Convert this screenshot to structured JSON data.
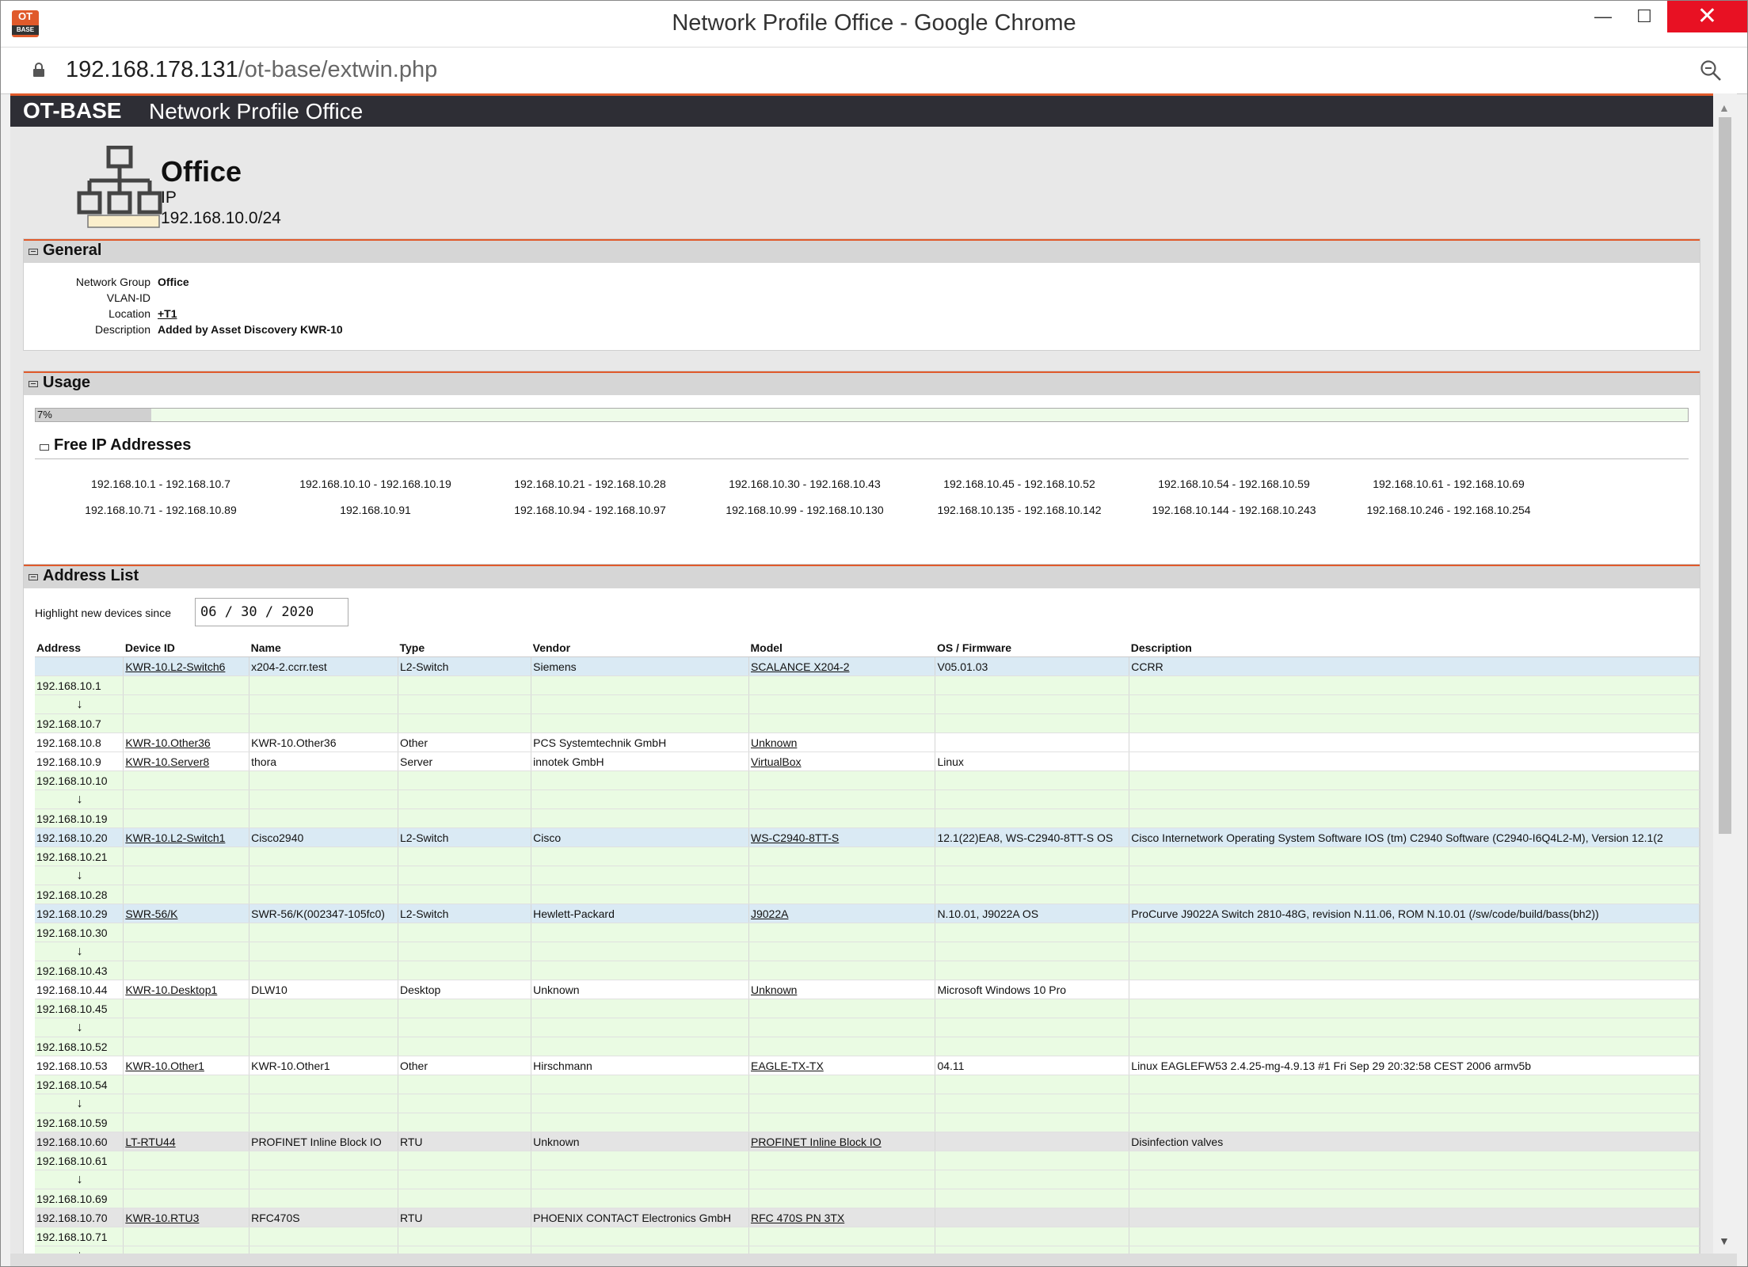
{
  "window": {
    "logo_top": "OT",
    "logo_bottom": "BASE",
    "title": "Network Profile Office - Google Chrome",
    "minimize": "—",
    "maximize": "☐",
    "close": "✕"
  },
  "addressbar": {
    "url_host": "192.168.178.131",
    "url_path": "/ot-base/extwin.php"
  },
  "header": {
    "brand": "OT-BASE",
    "title": "Network Profile  Office"
  },
  "profile": {
    "name": "Office",
    "type": "IP",
    "subnet": "192.168.10.0/24"
  },
  "general": {
    "title": "General",
    "fields": [
      {
        "key": "Network Group",
        "value": "Office",
        "link": false
      },
      {
        "key": "VLAN-ID",
        "value": "",
        "link": false
      },
      {
        "key": "Location",
        "value": "+T1",
        "link": true
      },
      {
        "key": "Description",
        "value": "Added by Asset Discovery KWR-10",
        "link": false
      }
    ]
  },
  "usage": {
    "title": "Usage",
    "percent": 7,
    "label": "7%",
    "free_title": "Free IP Addresses",
    "free": [
      "192.168.10.1 - 192.168.10.7",
      "192.168.10.10 - 192.168.10.19",
      "192.168.10.21 - 192.168.10.28",
      "192.168.10.30 - 192.168.10.43",
      "192.168.10.45 - 192.168.10.52",
      "192.168.10.54 - 192.168.10.59",
      "192.168.10.61 - 192.168.10.69",
      "192.168.10.71 - 192.168.10.89",
      "192.168.10.91",
      "192.168.10.94 - 192.168.10.97",
      "192.168.10.99 - 192.168.10.130",
      "192.168.10.135 - 192.168.10.142",
      "192.168.10.144 - 192.168.10.243",
      "192.168.10.246 - 192.168.10.254"
    ]
  },
  "address_list": {
    "title": "Address List",
    "highlight_label": "Highlight new devices since",
    "highlight_value": "06 / 30 / 2020",
    "columns": [
      "Address",
      "Device ID",
      "Name",
      "Type",
      "Vendor",
      "Model",
      "OS / Firmware",
      "Description"
    ],
    "rows": [
      {
        "kind": "hl",
        "cells": [
          "",
          "KWR-10.L2-Switch6",
          "x204-2.ccrr.test",
          "L2-Switch",
          "Siemens",
          "SCALANCE X204-2",
          "V05.01.03",
          "CCRR"
        ]
      },
      {
        "kind": "free",
        "cells": [
          "192.168.10.1"
        ]
      },
      {
        "kind": "arrow",
        "cells": [
          "↓"
        ]
      },
      {
        "kind": "free",
        "cells": [
          "192.168.10.7"
        ]
      },
      {
        "kind": "dev",
        "cells": [
          "192.168.10.8",
          "KWR-10.Other36",
          "KWR-10.Other36",
          "Other",
          "PCS Systemtechnik GmbH",
          "Unknown",
          "",
          ""
        ]
      },
      {
        "kind": "dev",
        "cells": [
          "192.168.10.9",
          "KWR-10.Server8",
          "thora",
          "Server",
          "innotek GmbH",
          "VirtualBox",
          "Linux",
          ""
        ]
      },
      {
        "kind": "free",
        "cells": [
          "192.168.10.10"
        ]
      },
      {
        "kind": "arrow",
        "cells": [
          "↓"
        ]
      },
      {
        "kind": "free",
        "cells": [
          "192.168.10.19"
        ]
      },
      {
        "kind": "hl",
        "cells": [
          "192.168.10.20",
          "KWR-10.L2-Switch1",
          "Cisco2940",
          "L2-Switch",
          "Cisco",
          "WS-C2940-8TT-S",
          "12.1(22)EA8, WS-C2940-8TT-S OS",
          "Cisco Internetwork Operating System Software IOS (tm) C2940 Software (C2940-I6Q4L2-M), Version 12.1(2"
        ]
      },
      {
        "kind": "free",
        "cells": [
          "192.168.10.21"
        ]
      },
      {
        "kind": "arrow",
        "cells": [
          "↓"
        ]
      },
      {
        "kind": "free",
        "cells": [
          "192.168.10.28"
        ]
      },
      {
        "kind": "hl",
        "cells": [
          "192.168.10.29",
          "SWR-56/K",
          "SWR-56/K(002347-105fc0)",
          "L2-Switch",
          "Hewlett-Packard",
          "J9022A",
          "N.10.01, J9022A OS",
          "ProCurve J9022A Switch 2810-48G, revision N.11.06, ROM N.10.01 (/sw/code/build/bass(bh2))"
        ]
      },
      {
        "kind": "free",
        "cells": [
          "192.168.10.30"
        ]
      },
      {
        "kind": "arrow",
        "cells": [
          "↓"
        ]
      },
      {
        "kind": "free",
        "cells": [
          "192.168.10.43"
        ]
      },
      {
        "kind": "dev",
        "cells": [
          "192.168.10.44",
          "KWR-10.Desktop1",
          "DLW10",
          "Desktop",
          "Unknown",
          "Unknown",
          "Microsoft Windows 10 Pro",
          ""
        ]
      },
      {
        "kind": "free",
        "cells": [
          "192.168.10.45"
        ]
      },
      {
        "kind": "arrow",
        "cells": [
          "↓"
        ]
      },
      {
        "kind": "free",
        "cells": [
          "192.168.10.52"
        ]
      },
      {
        "kind": "dev",
        "cells": [
          "192.168.10.53",
          "KWR-10.Other1",
          "KWR-10.Other1",
          "Other",
          "Hirschmann",
          "EAGLE-TX-TX",
          "04.11",
          "Linux EAGLEFW53 2.4.25-mg-4.9.13 #1 Fri Sep 29 20:32:58 CEST 2006 armv5b"
        ]
      },
      {
        "kind": "free",
        "cells": [
          "192.168.10.54"
        ]
      },
      {
        "kind": "arrow",
        "cells": [
          "↓"
        ]
      },
      {
        "kind": "free",
        "cells": [
          "192.168.10.59"
        ]
      },
      {
        "kind": "gray",
        "cells": [
          "192.168.10.60",
          "LT-RTU44",
          "PROFINET Inline Block IO",
          "RTU",
          "Unknown",
          "PROFINET Inline Block IO",
          "",
          "Disinfection valves"
        ]
      },
      {
        "kind": "free",
        "cells": [
          "192.168.10.61"
        ]
      },
      {
        "kind": "arrow",
        "cells": [
          "↓"
        ]
      },
      {
        "kind": "free",
        "cells": [
          "192.168.10.69"
        ]
      },
      {
        "kind": "gray",
        "cells": [
          "192.168.10.70",
          "KWR-10.RTU3",
          "RFC470S",
          "RTU",
          "PHOENIX CONTACT Electronics GmbH",
          "RFC 470S PN 3TX",
          "",
          ""
        ]
      },
      {
        "kind": "free",
        "cells": [
          "192.168.10.71"
        ]
      },
      {
        "kind": "arrow",
        "cells": [
          "↓"
        ]
      }
    ]
  }
}
